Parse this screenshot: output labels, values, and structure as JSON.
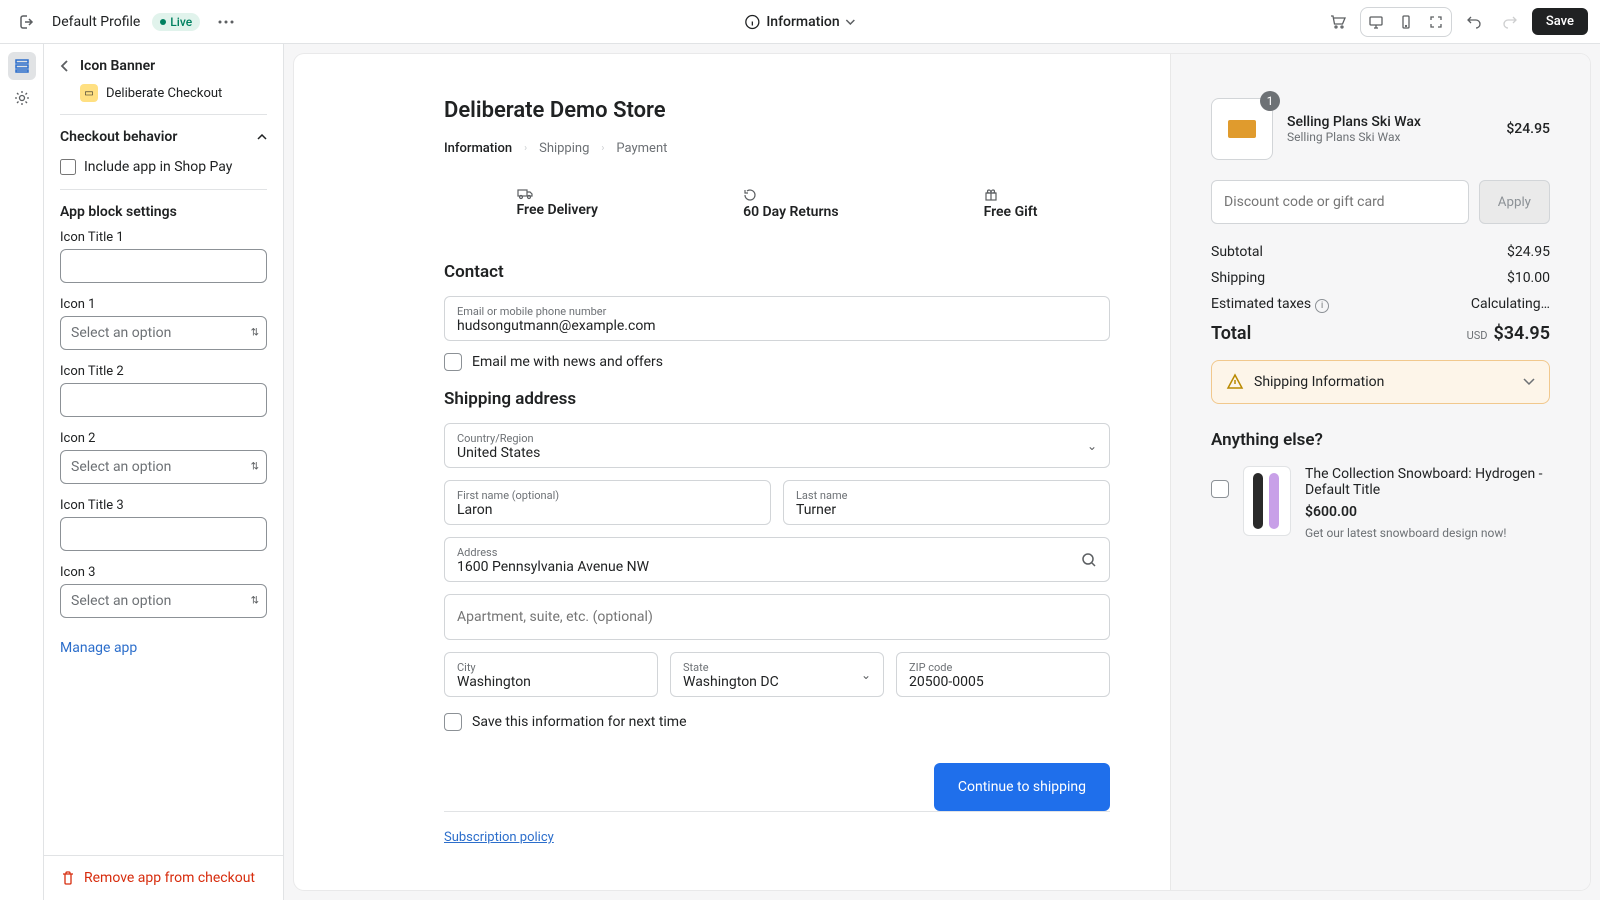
{
  "topbar": {
    "profile": "Default Profile",
    "live": "Live",
    "page_label": "Information",
    "save": "Save"
  },
  "sidebar": {
    "title": "Icon Banner",
    "app_name": "Deliberate Checkout",
    "behavior_title": "Checkout behavior",
    "include_label": "Include app in Shop Pay",
    "settings_title": "App block settings",
    "fields": [
      {
        "label": "Icon Title 1",
        "type": "text"
      },
      {
        "label": "Icon 1",
        "type": "select",
        "placeholder": "Select an option"
      },
      {
        "label": "Icon Title 2",
        "type": "text"
      },
      {
        "label": "Icon 2",
        "type": "select",
        "placeholder": "Select an option"
      },
      {
        "label": "Icon Title 3",
        "type": "text"
      },
      {
        "label": "Icon 3",
        "type": "select",
        "placeholder": "Select an option"
      }
    ],
    "manage": "Manage app",
    "remove": "Remove app from checkout"
  },
  "checkout": {
    "store": "Deliberate Demo Store",
    "crumbs": [
      "Information",
      "Shipping",
      "Payment"
    ],
    "banner": [
      "Free Delivery",
      "60 Day Returns",
      "Free Gift"
    ],
    "contact_title": "Contact",
    "email_label": "Email or mobile phone number",
    "email_value": "hudsongutmann@example.com",
    "news_label": "Email me with news and offers",
    "ship_title": "Shipping address",
    "country_label": "Country/Region",
    "country_value": "United States",
    "first_label": "First name (optional)",
    "first_value": "Laron",
    "last_label": "Last name",
    "last_value": "Turner",
    "addr_label": "Address",
    "addr_value": "1600 Pennsylvania Avenue NW",
    "apt_placeholder": "Apartment, suite, etc. (optional)",
    "city_label": "City",
    "city_value": "Washington",
    "state_label": "State",
    "state_value": "Washington DC",
    "zip_label": "ZIP code",
    "zip_value": "20500-0005",
    "save_label": "Save this information for next time",
    "continue": "Continue to shipping",
    "sub_policy": "Subscription policy"
  },
  "summary": {
    "item_name": "Selling Plans Ski Wax",
    "item_variant": "Selling Plans Ski Wax",
    "item_price": "$24.95",
    "item_qty": "1",
    "discount_placeholder": "Discount code or gift card",
    "apply": "Apply",
    "subtotal_label": "Subtotal",
    "subtotal_value": "$24.95",
    "shipping_label": "Shipping",
    "shipping_value": "$10.00",
    "tax_label": "Estimated taxes",
    "tax_value": "Calculating…",
    "total_label": "Total",
    "total_currency": "USD",
    "total_value": "$34.95",
    "alert_text": "Shipping Information",
    "anything": "Anything else?",
    "upsell_name": "The Collection Snowboard: Hydrogen - Default Title",
    "upsell_price": "$600.00",
    "upsell_desc": "Get our latest snowboard design now!"
  }
}
